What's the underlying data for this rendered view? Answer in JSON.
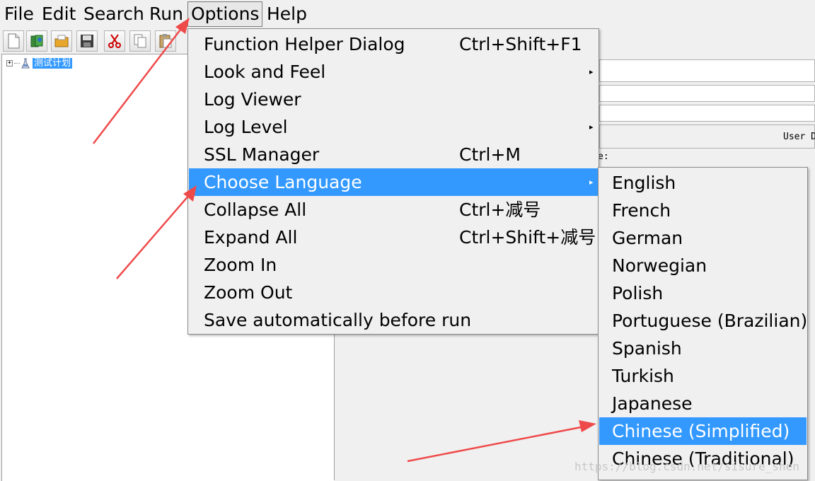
{
  "menubar": {
    "items": [
      {
        "label": "File"
      },
      {
        "label": "Edit"
      },
      {
        "label": "Search"
      },
      {
        "label": "Run"
      },
      {
        "label": "Options"
      },
      {
        "label": "Help"
      }
    ]
  },
  "toolbar": {
    "buttons": [
      "new-icon",
      "templates-icon",
      "open-icon",
      "save-icon",
      "cut-icon",
      "copy-icon",
      "paste-icon"
    ]
  },
  "tree": {
    "root_label": "测试计划",
    "expander": "+"
  },
  "right_panel": {
    "user_label": "User D",
    "e_label": "e:"
  },
  "options_menu": {
    "items": [
      {
        "label": "Function Helper Dialog",
        "accelerator": "Ctrl+Shift+F1",
        "submenu": ""
      },
      {
        "label": "Look and Feel",
        "accelerator": "",
        "submenu": "▸"
      },
      {
        "label": "Log Viewer",
        "accelerator": "",
        "submenu": ""
      },
      {
        "label": "Log Level",
        "accelerator": "",
        "submenu": "▸"
      },
      {
        "label": "SSL Manager",
        "accelerator": "Ctrl+M",
        "submenu": ""
      },
      {
        "label": "Choose Language",
        "accelerator": "",
        "submenu": "▸"
      },
      {
        "label": "Collapse All",
        "accelerator": "Ctrl+减号",
        "submenu": ""
      },
      {
        "label": "Expand All",
        "accelerator": "Ctrl+Shift+减号",
        "submenu": ""
      },
      {
        "label": "Zoom In",
        "accelerator": "",
        "submenu": ""
      },
      {
        "label": "Zoom Out",
        "accelerator": "",
        "submenu": ""
      },
      {
        "label": "Save automatically before run",
        "accelerator": "",
        "submenu": ""
      }
    ],
    "highlighted": "Choose Language"
  },
  "language_menu": {
    "items": [
      {
        "label": "English"
      },
      {
        "label": "French"
      },
      {
        "label": "German"
      },
      {
        "label": "Norwegian"
      },
      {
        "label": "Polish"
      },
      {
        "label": "Portuguese (Brazilian)"
      },
      {
        "label": "Spanish"
      },
      {
        "label": "Turkish"
      },
      {
        "label": "Japanese"
      },
      {
        "label": "Chinese (Simplified)"
      },
      {
        "label": "Chinese (Traditional)"
      }
    ],
    "highlighted": "Chinese (Simplified)"
  },
  "watermark": "https://blog.csdn.net/sisure_shen",
  "colors": {
    "highlight": "#3399ff",
    "menu_bg": "#f0f0f0",
    "annotation_arrow": "#ef4a4a"
  }
}
